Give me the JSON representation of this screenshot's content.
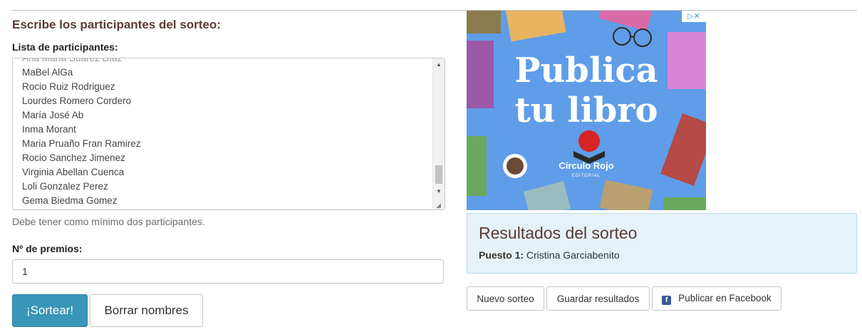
{
  "form": {
    "heading": "Escribe los participantes del sorteo:",
    "list_label": "Lista de participantes:",
    "participants": [
      "Ana María Suárez Díaz",
      "MaBel AlGa",
      "Rocio Ruiz Rodriguez",
      "Lourdes Romero Cordero",
      "María José Ab",
      "Inma Morant",
      "Maria Pruaño Fran Ramirez",
      "Rocio Sanchez Jimenez",
      "Virginia Abellan Cuenca",
      "Loli Gonzalez Perez",
      "Gema Biedma Gomez"
    ],
    "hint": "Debe tener como mínimo dos participantes.",
    "prizes_label": "Nº de premios:",
    "prizes_value": "1",
    "draw_button": "¡Sortear!",
    "clear_button": "Borrar nombres"
  },
  "ad": {
    "title_line1": "Publica",
    "title_line2": "tu libro",
    "brand": "Círculo Rojo",
    "brand_sub": "EDITORIAL",
    "choices_label": "▷✕",
    "bg_color": "#5f9de8"
  },
  "results": {
    "title": "Resultados del sorteo",
    "position_label": "Puesto 1:",
    "winner": "Cristina Garciabenito"
  },
  "actions": {
    "new_draw": "Nuevo sorteo",
    "save_results": "Guardar resultados",
    "publish_facebook": "Publicar en Facebook"
  },
  "colors": {
    "accent": "#3a96b8",
    "heading": "#5a3a34",
    "results_bg": "#e6f2f8",
    "facebook": "#3b5998"
  }
}
